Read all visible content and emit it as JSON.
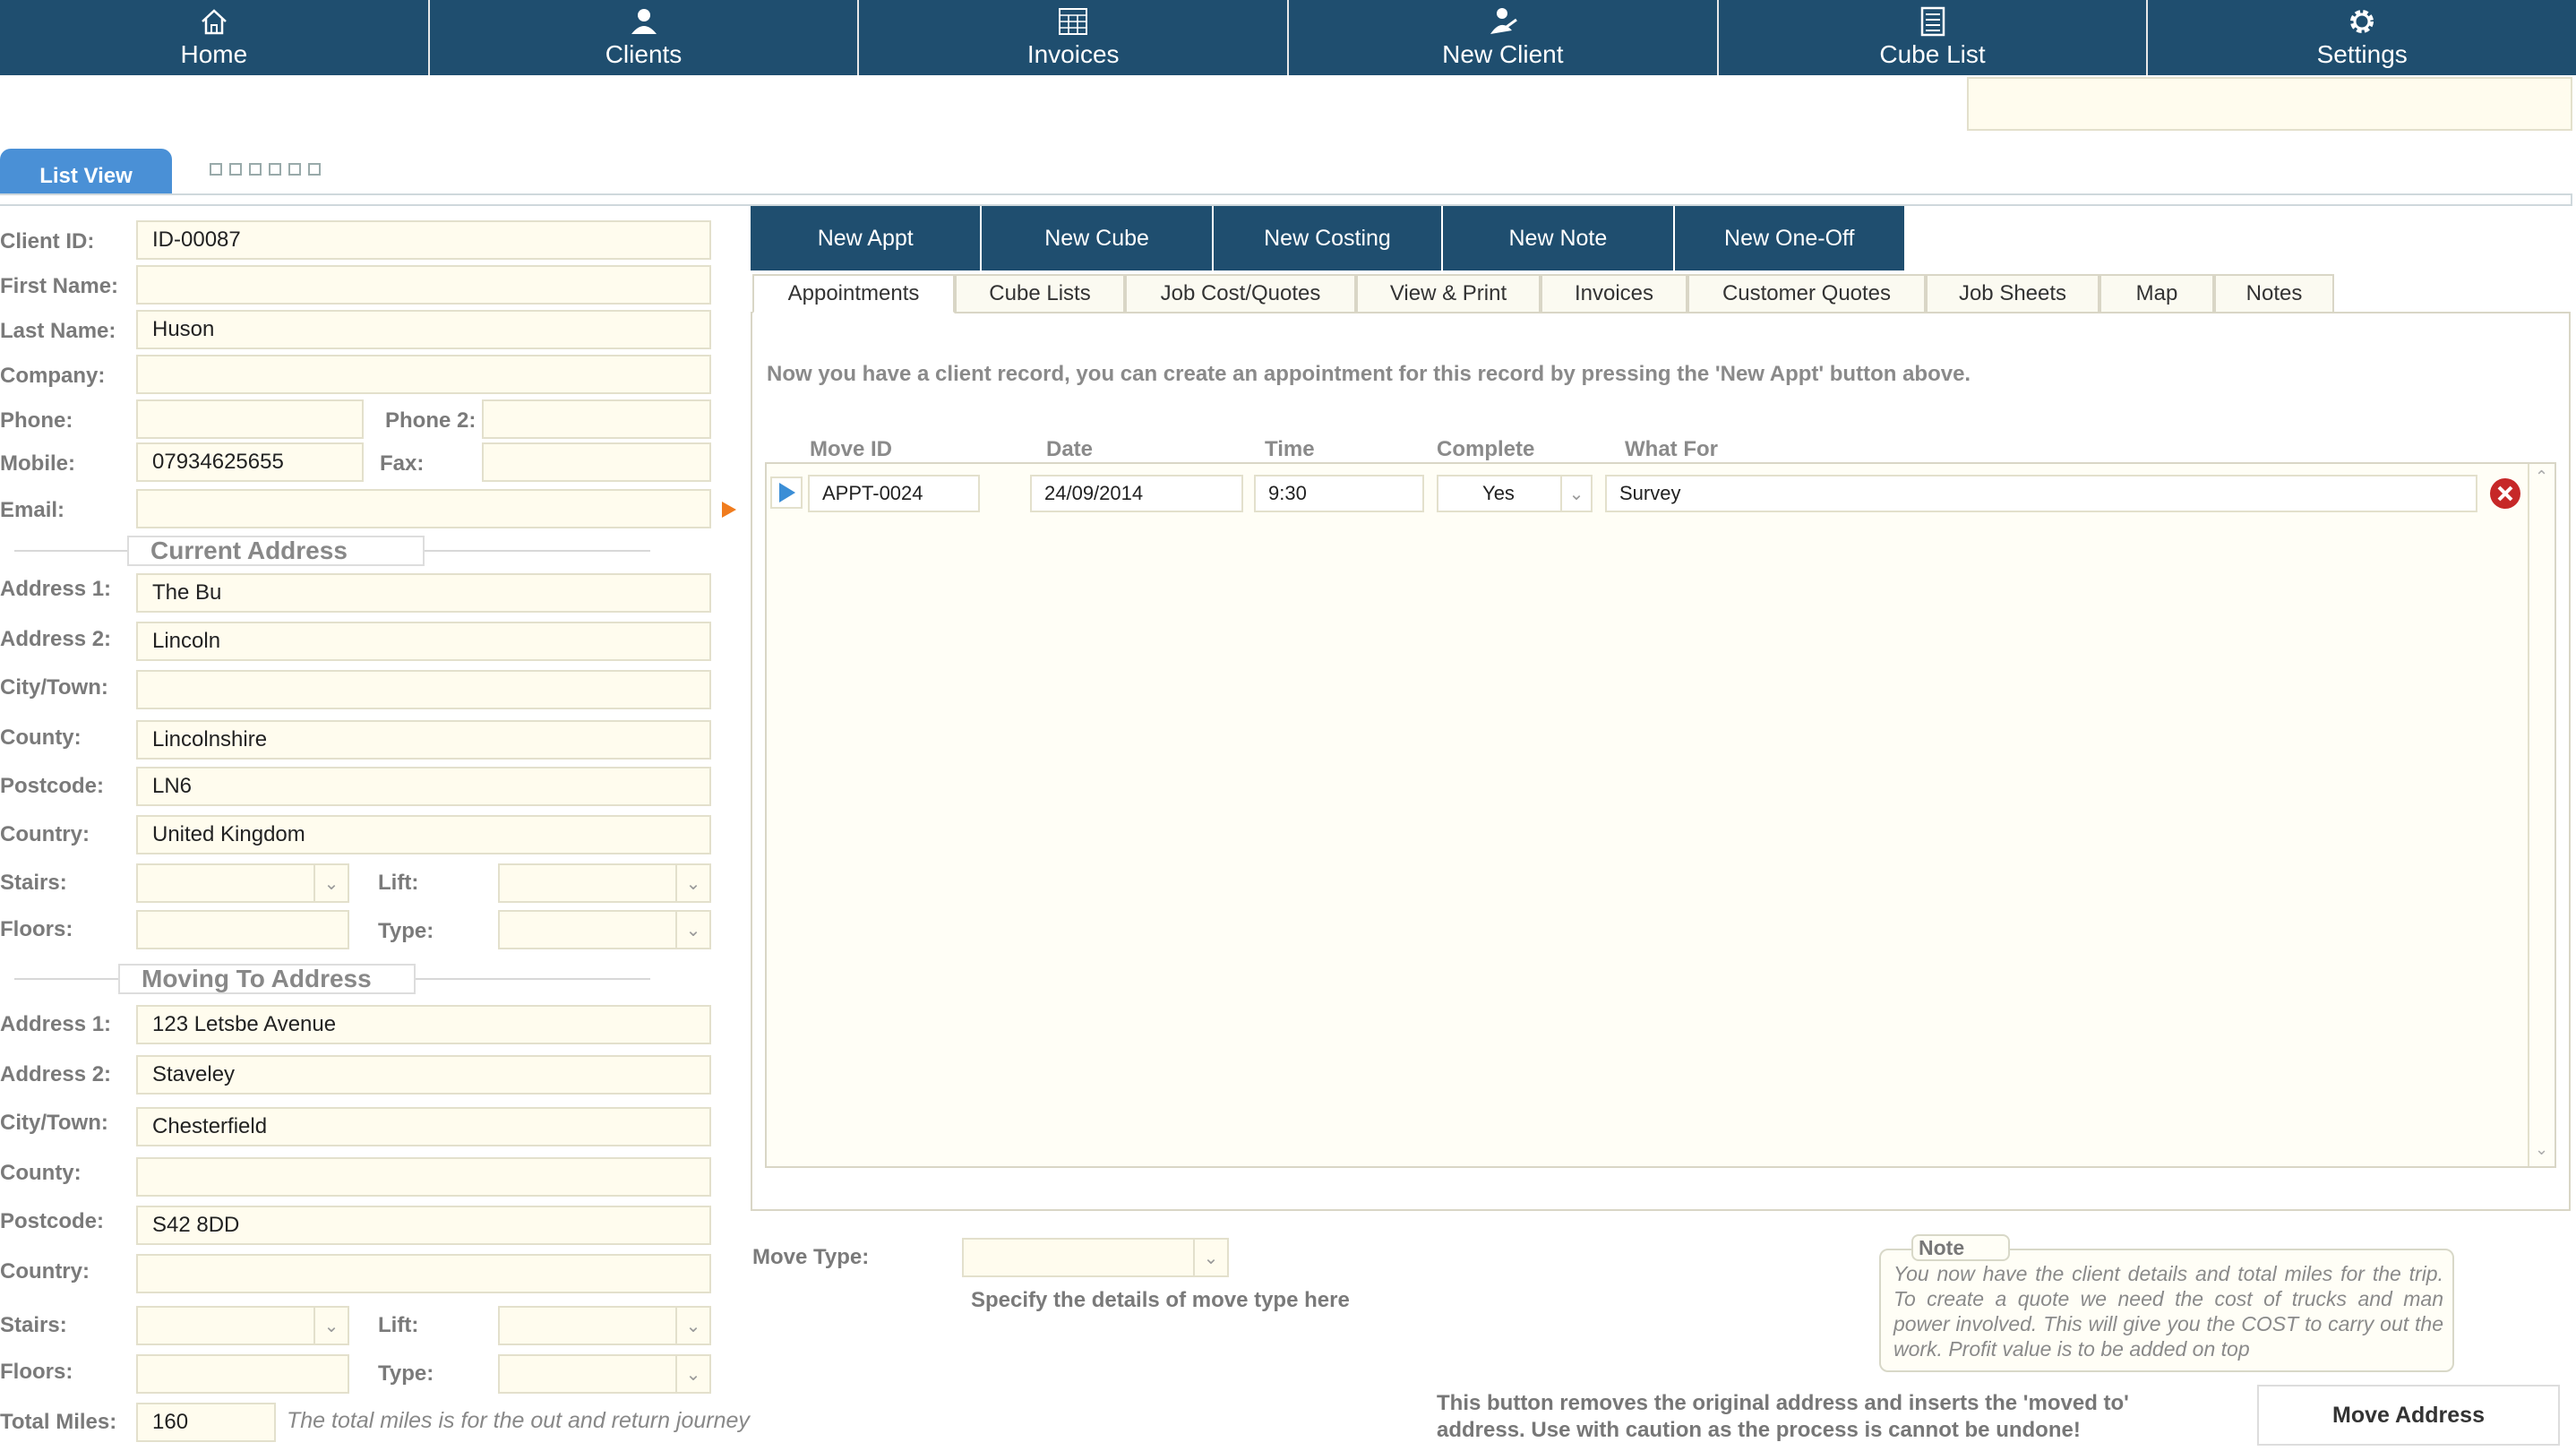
{
  "nav": [
    {
      "label": "Home",
      "icon": "home-icon"
    },
    {
      "label": "Clients",
      "icon": "person-icon"
    },
    {
      "label": "Invoices",
      "icon": "invoice-icon"
    },
    {
      "label": "New Client",
      "icon": "add-person-icon"
    },
    {
      "label": "Cube List",
      "icon": "list-icon"
    },
    {
      "label": "Settings",
      "icon": "gear-icon"
    }
  ],
  "tabs": {
    "list_view": "List View"
  },
  "client": {
    "labels": {
      "client_id": "Client ID:",
      "first_name": "First Name:",
      "last_name": "Last Name:",
      "company": "Company:",
      "phone": "Phone:",
      "phone2": "Phone 2:",
      "mobile": "Mobile:",
      "fax": "Fax:",
      "email": "Email:"
    },
    "client_id": "ID-00087",
    "first_name": "",
    "last_name": "Huson",
    "company": "",
    "phone": "",
    "phone2": "",
    "mobile": "07934625655",
    "fax": "",
    "email": ""
  },
  "current_address": {
    "title": "Current Address",
    "labels": {
      "address1": "Address 1:",
      "address2": "Address 2:",
      "city": "City/Town:",
      "county": "County:",
      "postcode": "Postcode:",
      "country": "Country:",
      "stairs": "Stairs:",
      "lift": "Lift:",
      "floors": "Floors:",
      "type": "Type:"
    },
    "address1": "The Bu",
    "address2": "Lincoln",
    "city": "",
    "county": "Lincolnshire",
    "postcode": "LN6",
    "country": "United Kingdom",
    "stairs": "",
    "lift": "",
    "floors": "",
    "type": ""
  },
  "moving_address": {
    "title": "Moving To Address",
    "labels": {
      "address1": "Address 1:",
      "address2": "Address 2:",
      "city": "City/Town:",
      "county": "County:",
      "postcode": "Postcode:",
      "country": "Country:",
      "stairs": "Stairs:",
      "lift": "Lift:",
      "floors": "Floors:",
      "type": "Type:"
    },
    "address1": "123 Letsbe Avenue",
    "address2": "Staveley",
    "city": "Chesterfield",
    "county": "",
    "postcode": "S42 8DD",
    "country": "",
    "stairs": "",
    "lift": "",
    "floors": "",
    "type": ""
  },
  "total_miles": {
    "label": "Total Miles:",
    "value": "160",
    "hint": "The total miles is for the out and return journey"
  },
  "actions": [
    "New Appt",
    "New Cube",
    "New Costing",
    "New Note",
    "New One-Off"
  ],
  "sub_tabs": [
    "Appointments",
    "Cube Lists",
    "Job Cost/Quotes",
    "View & Print",
    "Invoices",
    "Customer Quotes",
    "Job Sheets",
    "Map",
    "Notes"
  ],
  "appointments": {
    "info": "Now you have a client record, you can create an appointment for this record by pressing the 'New Appt' button above.",
    "headers": [
      "Move ID",
      "Date",
      "Time",
      "Complete",
      "What For"
    ],
    "rows": [
      {
        "move_id": "APPT-0024",
        "date": "24/09/2014",
        "time": "9:30",
        "complete": "Yes",
        "what_for": "Survey"
      }
    ]
  },
  "move_type": {
    "label": "Move Type:",
    "value": "",
    "hint": "Specify the details of move type here"
  },
  "note": {
    "title": "Note",
    "text": "You now have the client details and total miles for the trip. To create a quote we need the cost of trucks and man power involved. This will give you the COST to carry out the work. Profit value is to be added on top"
  },
  "move_address": {
    "warning": "This button removes the original address and inserts the 'moved to' address. Use with caution as the process is cannot be undone!",
    "button": "Move Address"
  },
  "colors": {
    "nav_bg": "#1f4e6f",
    "tab_blue": "#4a90d6",
    "field_bg": "#fffcee",
    "delete_red": "#c62828",
    "arrow_orange": "#f07c1e"
  }
}
